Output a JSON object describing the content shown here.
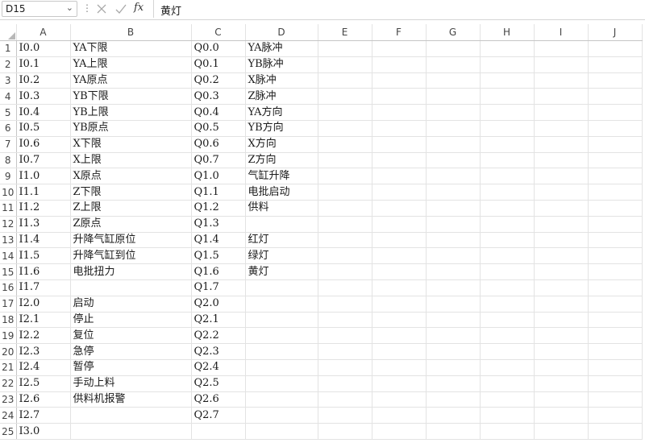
{
  "formula_bar": {
    "name_box": "D15",
    "fx_label": "fx",
    "formula_value": "黄灯"
  },
  "columns": [
    "A",
    "B",
    "C",
    "D",
    "E",
    "F",
    "G",
    "H",
    "I",
    "J"
  ],
  "rows": [
    {
      "num": "1",
      "a": "I0.0",
      "b": "YA下限",
      "c": "Q0.0",
      "d": "YA脉冲"
    },
    {
      "num": "2",
      "a": "I0.1",
      "b": "YA上限",
      "c": "Q0.1",
      "d": "YB脉冲"
    },
    {
      "num": "3",
      "a": "I0.2",
      "b": "YA原点",
      "c": "Q0.2",
      "d": "X脉冲"
    },
    {
      "num": "4",
      "a": "I0.3",
      "b": "YB下限",
      "c": "Q0.3",
      "d": "Z脉冲"
    },
    {
      "num": "5",
      "a": "I0.4",
      "b": "YB上限",
      "c": "Q0.4",
      "d": "YA方向"
    },
    {
      "num": "6",
      "a": "I0.5",
      "b": "YB原点",
      "c": "Q0.5",
      "d": "YB方向"
    },
    {
      "num": "7",
      "a": "I0.6",
      "b": "X下限",
      "c": "Q0.6",
      "d": "X方向"
    },
    {
      "num": "8",
      "a": "I0.7",
      "b": "X上限",
      "c": "Q0.7",
      "d": "Z方向"
    },
    {
      "num": "9",
      "a": "I1.0",
      "b": "X原点",
      "c": "Q1.0",
      "d": "气缸升降"
    },
    {
      "num": "10",
      "a": "I1.1",
      "b": "Z下限",
      "c": "Q1.1",
      "d": "电批启动"
    },
    {
      "num": "11",
      "a": "I1.2",
      "b": "Z上限",
      "c": "Q1.2",
      "d": "供料"
    },
    {
      "num": "12",
      "a": "I1.3",
      "b": "Z原点",
      "c": "Q1.3",
      "d": ""
    },
    {
      "num": "13",
      "a": "I1.4",
      "b": "升降气缸原位",
      "c": "Q1.4",
      "d": "红灯"
    },
    {
      "num": "14",
      "a": "I1.5",
      "b": "升降气缸到位",
      "c": "Q1.5",
      "d": "绿灯"
    },
    {
      "num": "15",
      "a": "I1.6",
      "b": "电批扭力",
      "c": "Q1.6",
      "d": "黄灯"
    },
    {
      "num": "16",
      "a": "I1.7",
      "b": "",
      "c": "Q1.7",
      "d": ""
    },
    {
      "num": "17",
      "a": "I2.0",
      "b": "启动",
      "c": "Q2.0",
      "d": ""
    },
    {
      "num": "18",
      "a": "I2.1",
      "b": "停止",
      "c": "Q2.1",
      "d": ""
    },
    {
      "num": "19",
      "a": "I2.2",
      "b": "复位",
      "c": "Q2.2",
      "d": ""
    },
    {
      "num": "20",
      "a": "I2.3",
      "b": "急停",
      "c": "Q2.3",
      "d": ""
    },
    {
      "num": "21",
      "a": "I2.4",
      "b": "暂停",
      "c": "Q2.4",
      "d": ""
    },
    {
      "num": "22",
      "a": "I2.5",
      "b": "手动上料",
      "c": "Q2.5",
      "d": ""
    },
    {
      "num": "23",
      "a": "I2.6",
      "b": "供料机报警",
      "c": "Q2.6",
      "d": ""
    },
    {
      "num": "24",
      "a": "I2.7",
      "b": "",
      "c": "Q2.7",
      "d": ""
    },
    {
      "num": "25",
      "a": "I3.0",
      "b": "",
      "c": "",
      "d": ""
    }
  ]
}
